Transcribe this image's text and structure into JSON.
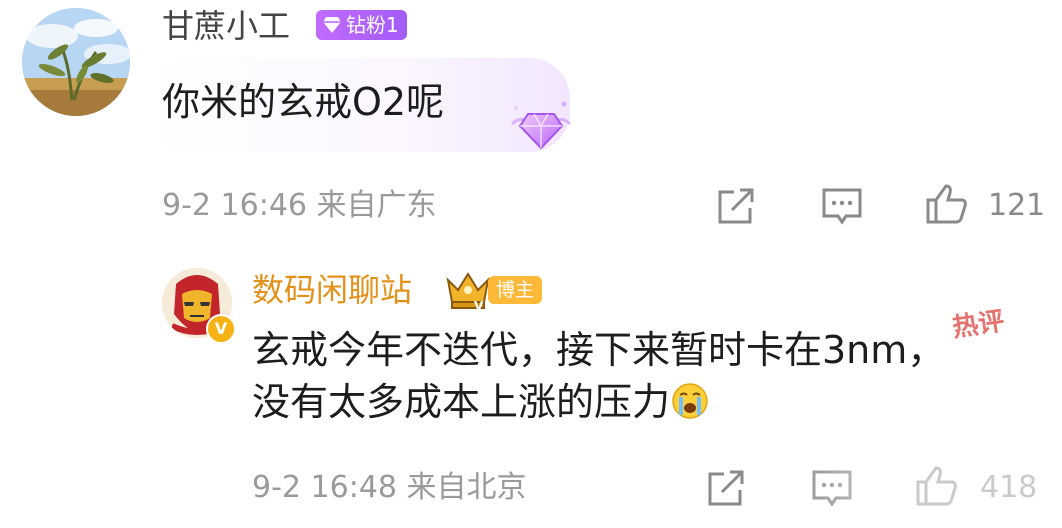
{
  "top_comment": {
    "username": "甘蔗小工",
    "badge": "钻粉1",
    "text": "你米的玄戒O2呢",
    "time": "9-2 16:46",
    "location": "来自广东",
    "likes": "121"
  },
  "reply": {
    "username": "数码闲聊站",
    "badge": "博主",
    "hot_label": "热评",
    "verified_mark": "V",
    "text_line1": "玄戒今年不迭代，接下来暂时卡在3nm，",
    "text_line2": "没有太多成本上涨的压力",
    "emoji": "crying-emoji",
    "time": "9-2 16:48",
    "location": "来自北京",
    "likes": "418"
  },
  "icons": {
    "share": "share-icon",
    "comment": "comment-icon",
    "like": "thumbs-up-icon"
  },
  "colors": {
    "host_name": "#e39118",
    "diamond_badge": "#b463fb",
    "meta_text": "#9a9a9a"
  }
}
